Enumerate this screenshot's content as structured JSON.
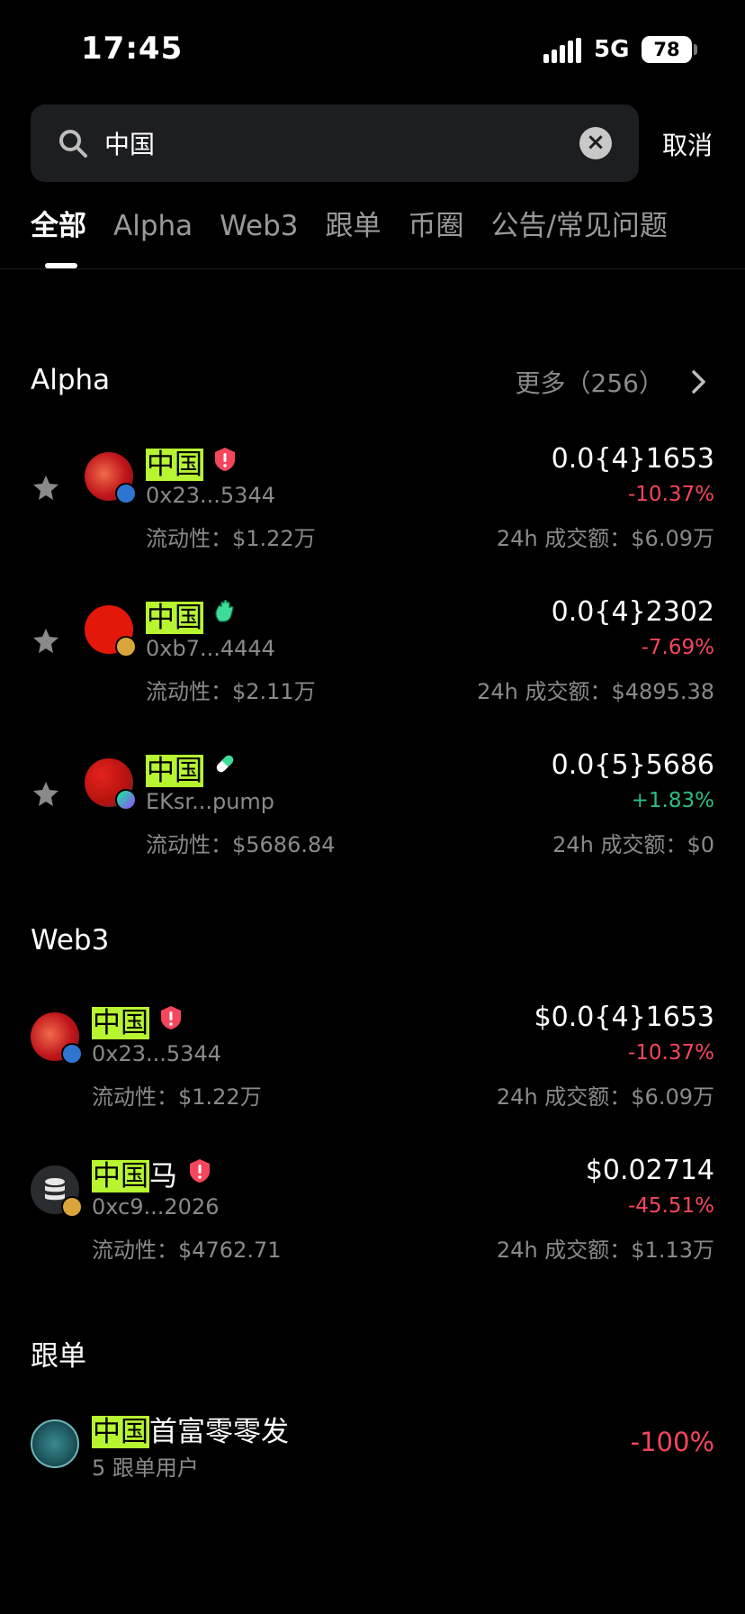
{
  "status_bar": {
    "time": "17:45",
    "network": "5G",
    "battery": "78"
  },
  "search": {
    "value": "中国",
    "placeholder": "",
    "cancel_label": "取消"
  },
  "tabs": [
    {
      "label": "全部"
    },
    {
      "label": "Alpha"
    },
    {
      "label": "Web3"
    },
    {
      "label": "跟单"
    },
    {
      "label": "币圈"
    },
    {
      "label": "公告/常见问题"
    }
  ],
  "alpha": {
    "title": "Alpha",
    "more_label": "更多（256）",
    "items": [
      {
        "highlight": "中国",
        "name_rest": "",
        "address": "0x23...5344",
        "liquidity": "流动性：$1.22万",
        "price": "0.0{4}1653",
        "change": "-10.37%",
        "volume": "24h 成交额：$6.09万",
        "tag": "warning-icon",
        "chain": "bnb"
      },
      {
        "highlight": "中国",
        "name_rest": "",
        "address": "0xb7...4444",
        "liquidity": "流动性：$2.11万",
        "price": "0.0{4}2302",
        "change": "-7.69%",
        "volume": "24h 成交额：$4895.38",
        "tag": "hand-icon",
        "chain": "bnb"
      },
      {
        "highlight": "中国",
        "name_rest": "",
        "address": "EKsr...pump",
        "liquidity": "流动性：$5686.84",
        "price": "0.0{5}5686",
        "change": "+1.83%",
        "volume": "24h 成交额：$0",
        "tag": "pill-icon",
        "chain": "solana"
      }
    ]
  },
  "web3": {
    "title": "Web3",
    "items": [
      {
        "highlight": "中国",
        "name_rest": "",
        "address": "0x23...5344",
        "liquidity": "流动性：$1.22万",
        "price": "$0.0{4}1653",
        "change": "-10.37%",
        "volume": "24h 成交额：$6.09万",
        "tag": "warning-icon"
      },
      {
        "highlight": "中国",
        "name_rest": "马",
        "address": "0xc9...2026",
        "liquidity": "流动性：$4762.71",
        "price": "$0.02714",
        "change": "-45.51%",
        "volume": "24h 成交额：$1.13万",
        "tag": "warning-icon"
      }
    ]
  },
  "copy_trading": {
    "title": "跟单",
    "items": [
      {
        "highlight": "中国",
        "name_rest": "首富零零发",
        "followers": "5 跟单用户",
        "change": "-100%"
      }
    ]
  },
  "colors": {
    "highlight": "#b7f531",
    "negative": "#f6465d",
    "positive": "#2ebd85",
    "muted": "#8a8a8a",
    "warning": "#f6465d"
  }
}
